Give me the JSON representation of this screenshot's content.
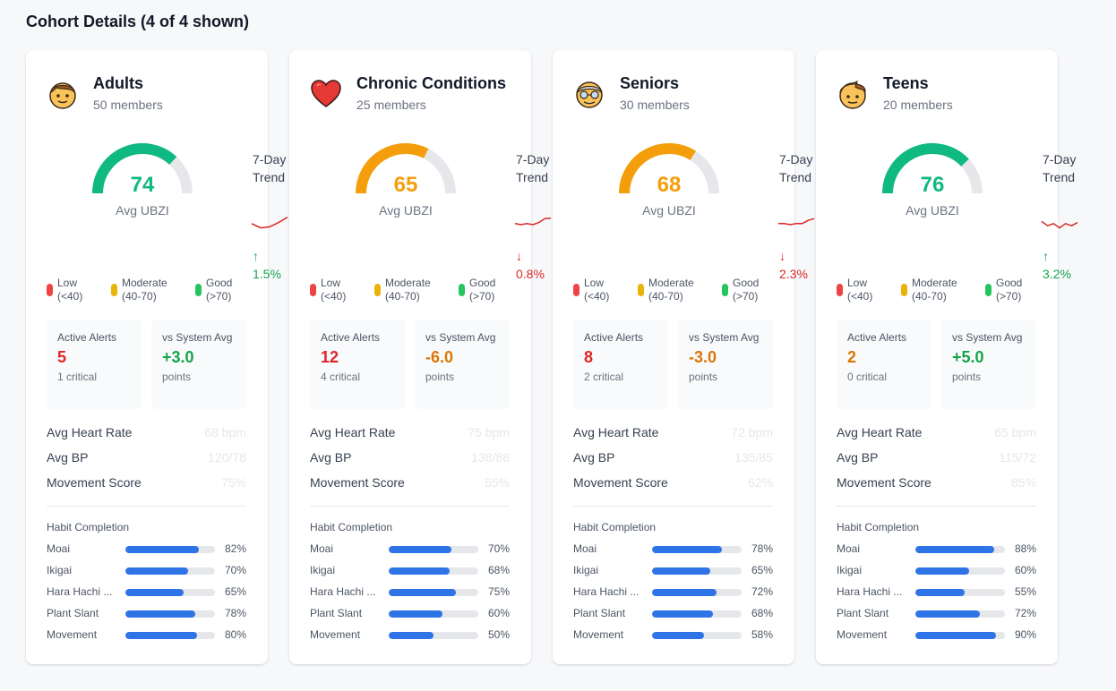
{
  "page_title": "Cohort Details (4 of 4 shown)",
  "labels": {
    "avg_ubzi": "Avg UBZI",
    "trend_title": "7-Day Trend",
    "legend": [
      {
        "name": "Low",
        "range": "(<40)",
        "color": "#ef4444"
      },
      {
        "name": "Moderate",
        "range": "(40-70)",
        "color": "#eab308"
      },
      {
        "name": "Good",
        "range": "(>70)",
        "color": "#22c55e"
      }
    ],
    "active_alerts": "Active Alerts",
    "vs_system_avg": "vs System Avg",
    "points": "points",
    "avg_heart_rate": "Avg Heart Rate",
    "avg_bp": "Avg BP",
    "movement_score": "Movement Score",
    "habit_completion": "Habit Completion"
  },
  "cohorts": [
    {
      "name": "Adults",
      "icon": "adult-face-icon",
      "members": "50 members",
      "ubzi": 74,
      "ubzi_fraction": 0.74,
      "ubzi_color": "#10b981",
      "trend_arrow": "↑",
      "trend_value": "1.5%",
      "trend_color": "#16a34a",
      "sparkline": [
        0.55,
        0.35,
        0.4,
        0.6,
        0.85
      ],
      "alerts": "5",
      "alerts_critical": "1 critical",
      "alerts_color": "#dc2626",
      "vs_avg": "+3.0",
      "vs_color": "#16a34a",
      "heart_rate": "68 bpm",
      "bp": "120/78",
      "movement": "75%",
      "habits": [
        {
          "name": "Moai",
          "pct": "82%",
          "value": 82
        },
        {
          "name": "Ikigai",
          "pct": "70%",
          "value": 70
        },
        {
          "name": "Hara Hachi Bu",
          "display": "Hara Hachi ...",
          "pct": "65%",
          "value": 65
        },
        {
          "name": "Plant Slant",
          "pct": "78%",
          "value": 78
        },
        {
          "name": "Movement",
          "pct": "80%",
          "value": 80
        }
      ]
    },
    {
      "name": "Chronic Conditions",
      "icon": "heart-icon",
      "members": "25 members",
      "ubzi": 65,
      "ubzi_fraction": 0.65,
      "ubzi_color": "#f59e0b",
      "trend_arrow": "↓",
      "trend_value": "0.8%",
      "trend_color": "#dc2626",
      "sparkline": [
        0.55,
        0.5,
        0.55,
        0.5,
        0.6,
        0.78,
        0.8
      ],
      "alerts": "12",
      "alerts_critical": "4 critical",
      "alerts_color": "#dc2626",
      "vs_avg": "-6.0",
      "vs_color": "#d97706",
      "heart_rate": "75 bpm",
      "bp": "138/88",
      "movement": "55%",
      "habits": [
        {
          "name": "Moai",
          "pct": "70%",
          "value": 70
        },
        {
          "name": "Ikigai",
          "pct": "68%",
          "value": 68
        },
        {
          "name": "Hara Hachi Bu",
          "display": "Hara Hachi ...",
          "pct": "75%",
          "value": 75
        },
        {
          "name": "Plant Slant",
          "pct": "60%",
          "value": 60
        },
        {
          "name": "Movement",
          "pct": "50%",
          "value": 50
        }
      ]
    },
    {
      "name": "Seniors",
      "icon": "older-person-icon",
      "members": "30 members",
      "ubzi": 68,
      "ubzi_fraction": 0.68,
      "ubzi_color": "#f59e0b",
      "trend_arrow": "↓",
      "trend_value": "2.3%",
      "trend_color": "#dc2626",
      "sparkline": [
        0.55,
        0.55,
        0.5,
        0.55,
        0.55,
        0.7,
        0.78
      ],
      "alerts": "8",
      "alerts_critical": "2 critical",
      "alerts_color": "#dc2626",
      "vs_avg": "-3.0",
      "vs_color": "#d97706",
      "heart_rate": "72 bpm",
      "bp": "135/85",
      "movement": "62%",
      "habits": [
        {
          "name": "Moai",
          "pct": "78%",
          "value": 78
        },
        {
          "name": "Ikigai",
          "pct": "65%",
          "value": 65
        },
        {
          "name": "Hara Hachi Bu",
          "display": "Hara Hachi ...",
          "pct": "72%",
          "value": 72
        },
        {
          "name": "Plant Slant",
          "pct": "68%",
          "value": 68
        },
        {
          "name": "Movement",
          "pct": "58%",
          "value": 58
        }
      ]
    },
    {
      "name": "Teens",
      "icon": "teen-face-icon",
      "members": "20 members",
      "ubzi": 76,
      "ubzi_fraction": 0.76,
      "ubzi_color": "#10b981",
      "trend_arrow": "↑",
      "trend_value": "3.2%",
      "trend_color": "#16a34a",
      "sparkline": [
        0.65,
        0.45,
        0.55,
        0.35,
        0.55,
        0.45,
        0.6
      ],
      "alerts": "2",
      "alerts_critical": "0 critical",
      "alerts_color": "#d97706",
      "vs_avg": "+5.0",
      "vs_color": "#16a34a",
      "heart_rate": "65 bpm",
      "bp": "115/72",
      "movement": "85%",
      "habits": [
        {
          "name": "Moai",
          "pct": "88%",
          "value": 88
        },
        {
          "name": "Ikigai",
          "pct": "60%",
          "value": 60
        },
        {
          "name": "Hara Hachi Bu",
          "display": "Hara Hachi ...",
          "pct": "55%",
          "value": 55
        },
        {
          "name": "Plant Slant",
          "pct": "72%",
          "value": 72
        },
        {
          "name": "Movement",
          "pct": "90%",
          "value": 90
        }
      ]
    }
  ]
}
